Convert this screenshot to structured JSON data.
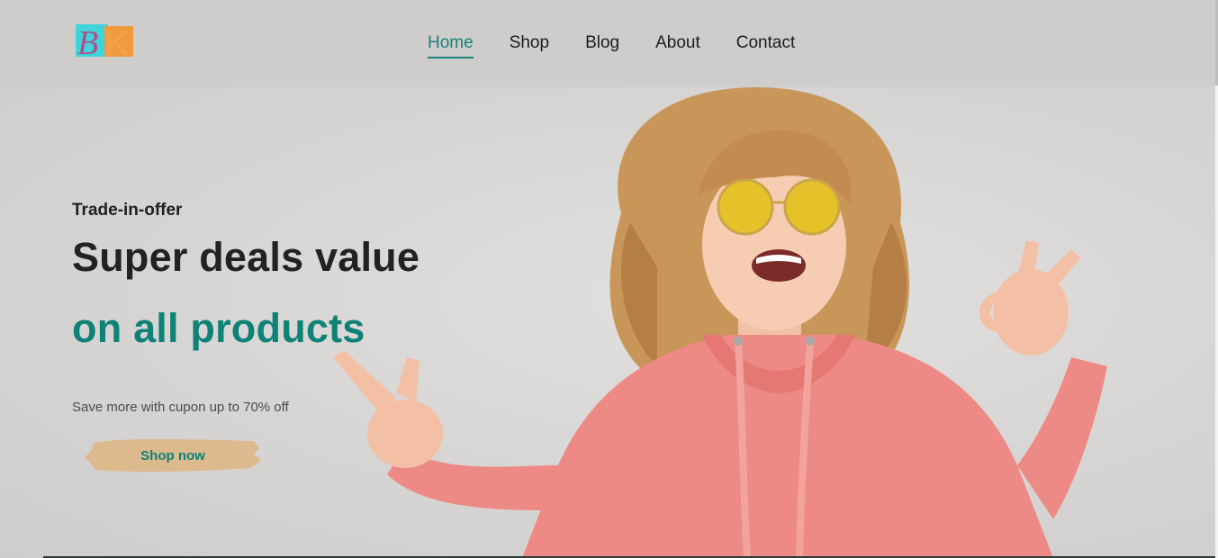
{
  "logo": {
    "letters": "BK",
    "icon": "bk-logo"
  },
  "nav": {
    "items": [
      {
        "label": "Home",
        "active": true
      },
      {
        "label": "Shop",
        "active": false
      },
      {
        "label": "Blog",
        "active": false
      },
      {
        "label": "About",
        "active": false
      },
      {
        "label": "Contact",
        "active": false
      }
    ]
  },
  "hero": {
    "kicker": "Trade-in-offer",
    "headline_line1": "Super deals value",
    "headline_line2": "on all products",
    "subtext": "Save more with cupon up to 70% off",
    "cta_label": "Shop now",
    "image": "woman-in-pink-hoodie-photo"
  },
  "colors": {
    "accent": "#0e8276",
    "header_bg": "#cfcdcc",
    "hero_bg": "#d8d6d5",
    "button_brush": "#ddb98e",
    "hoodie": "#ee8a85"
  }
}
